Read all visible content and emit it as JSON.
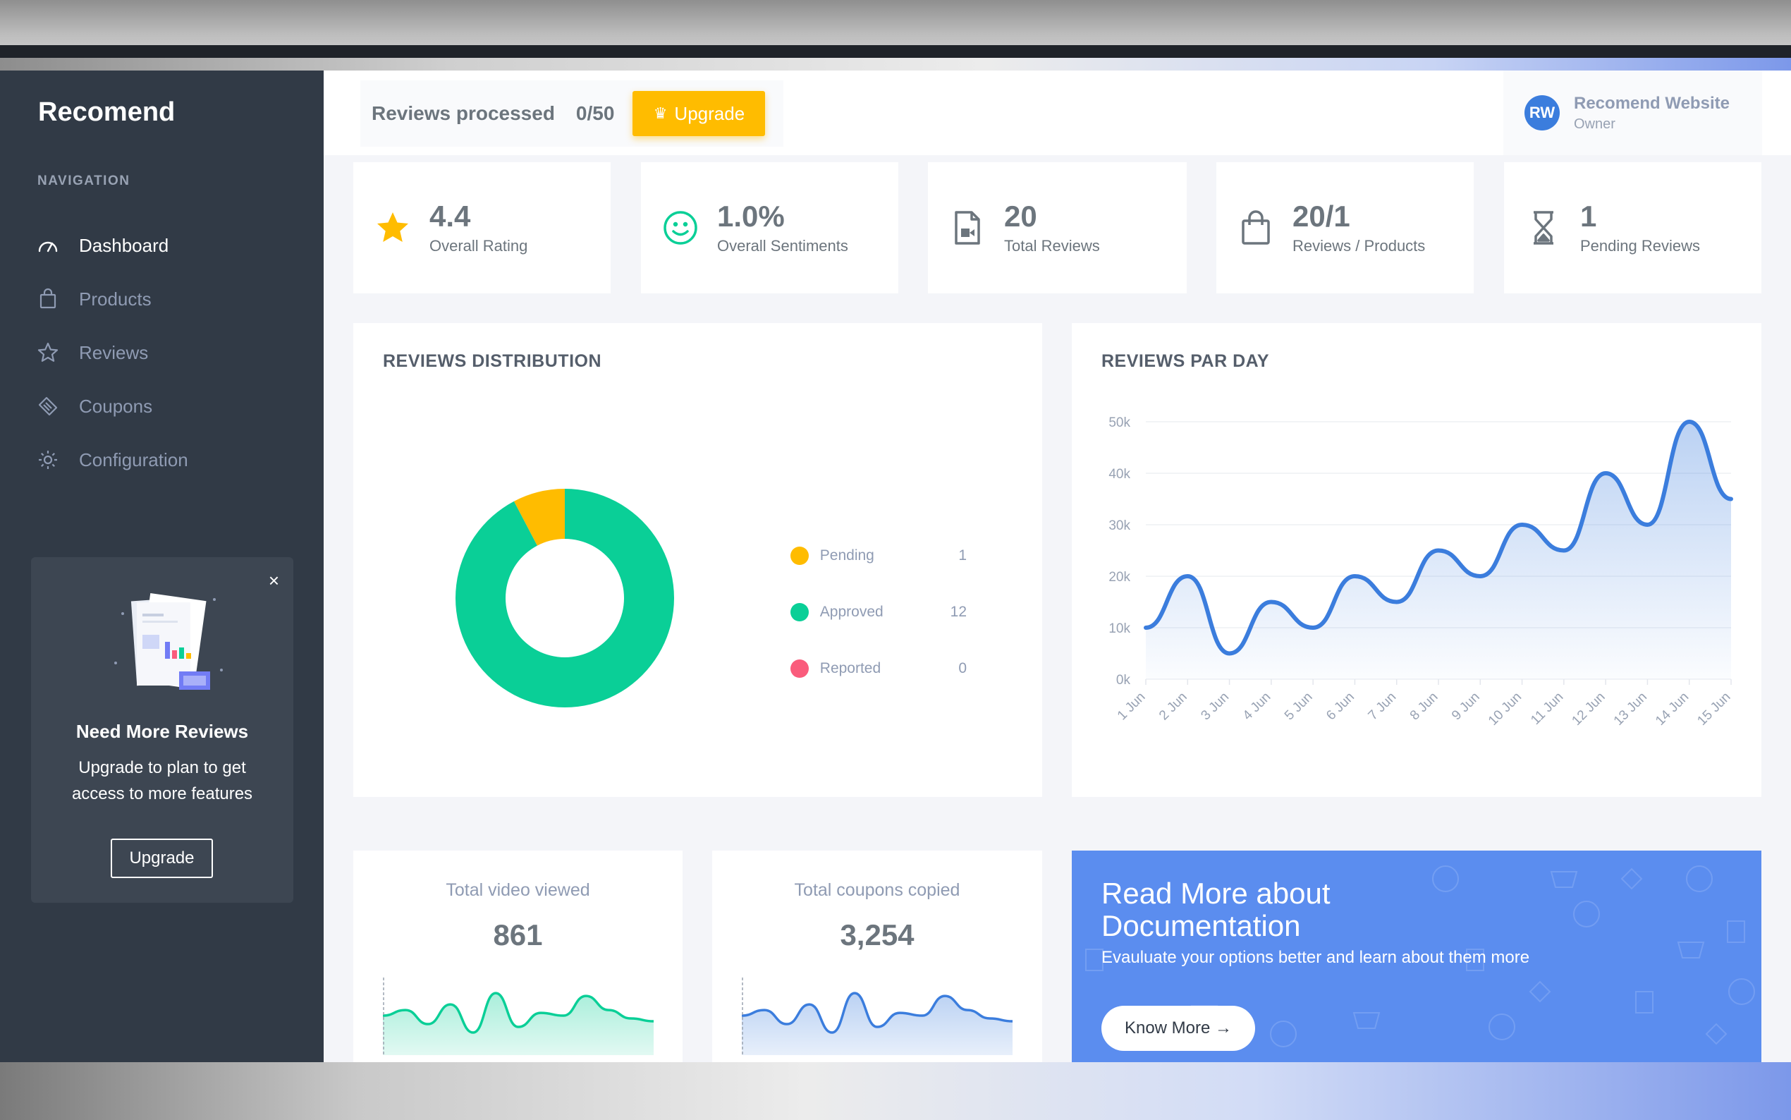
{
  "app": {
    "brand": "Recomend"
  },
  "sidebar": {
    "nav_title": "NAVIGATION",
    "items": [
      {
        "label": "Dashboard",
        "icon": "speedometer-icon",
        "active": true
      },
      {
        "label": "Products",
        "icon": "shopping-bag-icon",
        "active": false
      },
      {
        "label": "Reviews",
        "icon": "star-icon",
        "active": false
      },
      {
        "label": "Coupons",
        "icon": "tag-icon",
        "active": false
      },
      {
        "label": "Configuration",
        "icon": "gear-icon",
        "active": false
      }
    ],
    "promo": {
      "title": "Need More Reviews",
      "text": "Upgrade to plan to get access to more features",
      "button": "Upgrade",
      "close": "×"
    }
  },
  "header": {
    "quota_label": "Reviews processed",
    "quota_value": "0/50",
    "upgrade_label": "Upgrade",
    "user": {
      "initials": "RW",
      "name": "Recomend Website",
      "role": "Owner"
    }
  },
  "stats": [
    {
      "value": "4.4",
      "label": "Overall Rating",
      "icon": "star-icon",
      "color": "#ffbc00"
    },
    {
      "value": "1.0%",
      "label": "Overall Sentiments",
      "icon": "smile-icon",
      "color": "#0acf97"
    },
    {
      "value": "20",
      "label": "Total Reviews",
      "icon": "video-file-icon",
      "color": "#6c757d"
    },
    {
      "value": "20/1",
      "label": "Reviews / Products",
      "icon": "shopping-bag-icon",
      "color": "#6c757d"
    },
    {
      "value": "1",
      "label": "Pending Reviews",
      "icon": "hourglass-icon",
      "color": "#6c757d"
    }
  ],
  "distribution": {
    "title": "REVIEWS DISTRIBUTION",
    "items": [
      {
        "name": "Pending",
        "count": "1",
        "color": "#ffbc00"
      },
      {
        "name": "Approved",
        "count": "12",
        "color": "#0acf97"
      },
      {
        "name": "Reported",
        "count": "0",
        "color": "#fa5c7c"
      }
    ]
  },
  "per_day": {
    "title": "REVIEWS PAR DAY"
  },
  "chart_data": [
    {
      "type": "pie",
      "title": "REVIEWS DISTRIBUTION",
      "categories": [
        "Pending",
        "Approved",
        "Reported"
      ],
      "values": [
        1,
        12,
        0
      ],
      "colors": [
        "#ffbc00",
        "#0acf97",
        "#fa5c7c"
      ],
      "legend": "right"
    },
    {
      "type": "area",
      "title": "REVIEWS PAR DAY",
      "x": [
        "1 Jun",
        "2 Jun",
        "3 Jun",
        "4 Jun",
        "5 Jun",
        "6 Jun",
        "7 Jun",
        "8 Jun",
        "9 Jun",
        "10 Jun",
        "11 Jun",
        "12 Jun",
        "13 Jun",
        "14 Jun",
        "15 Jun"
      ],
      "y_ticks": [
        "0k",
        "10k",
        "20k",
        "30k",
        "40k",
        "50k"
      ],
      "ylim": [
        0,
        50000
      ],
      "series": [
        {
          "values": [
            10000,
            20000,
            5000,
            15000,
            10000,
            20000,
            15000,
            25000,
            20000,
            30000,
            25000,
            40000,
            30000,
            50000,
            35000
          ],
          "color": "#3b7ddd"
        }
      ],
      "grid": true
    },
    {
      "type": "area",
      "title": "Total video viewed",
      "series": [
        {
          "values": [
            12,
            14,
            9,
            16,
            6,
            20,
            8,
            13,
            12,
            19,
            14,
            11,
            10
          ],
          "color": "#0acf97"
        }
      ]
    },
    {
      "type": "area",
      "title": "Total coupons copied",
      "series": [
        {
          "values": [
            12,
            14,
            9,
            16,
            6,
            20,
            8,
            13,
            12,
            19,
            14,
            11,
            10
          ],
          "color": "#3b7ddd"
        }
      ]
    }
  ],
  "mini_cards": [
    {
      "title": "Total video viewed",
      "value": "861"
    },
    {
      "title": "Total coupons copied",
      "value": "3,254"
    }
  ],
  "doc": {
    "title": "Read More about Documentation",
    "subtitle": "Evauluate your options better and learn about them more",
    "button": "Know More →"
  }
}
